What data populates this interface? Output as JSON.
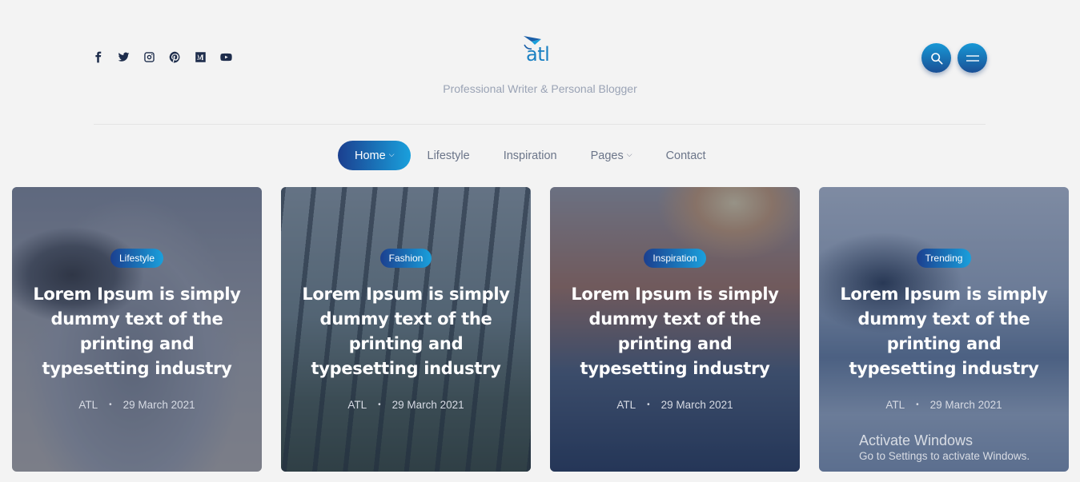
{
  "header": {
    "logo_text": "atl",
    "tagline": "Professional Writer & Personal Blogger",
    "social": [
      {
        "icon": "facebook-icon"
      },
      {
        "icon": "twitter-icon"
      },
      {
        "icon": "instagram-icon"
      },
      {
        "icon": "pinterest-icon"
      },
      {
        "icon": "medium-icon"
      },
      {
        "icon": "youtube-icon"
      }
    ]
  },
  "nav": {
    "items": [
      {
        "label": "Home",
        "chevron": "⌵",
        "active": true
      },
      {
        "label": "Lifestyle"
      },
      {
        "label": "Inspiration"
      },
      {
        "label": "Pages",
        "chevron": "⌵"
      },
      {
        "label": "Contact"
      }
    ]
  },
  "cards": [
    {
      "category": "Lifestyle",
      "title": "Lorem Ipsum is simply dummy text of the printing and typesetting industry",
      "author": "ATL",
      "dot": "•",
      "date": "29 March 2021"
    },
    {
      "category": "Fashion",
      "title": "Lorem Ipsum is simply dummy text of the printing and typesetting industry",
      "author": "ATL",
      "dot": "•",
      "date": "29 March 2021"
    },
    {
      "category": "Inspiration",
      "title": "Lorem Ipsum is simply dummy text of the printing and typesetting industry",
      "author": "ATL",
      "dot": "•",
      "date": "29 March 2021"
    },
    {
      "category": "Trending",
      "title": "Lorem Ipsum is simply dummy text of the printing and typesetting industry",
      "author": "ATL",
      "dot": "•",
      "date": "29 March 2021"
    }
  ],
  "watermark": {
    "line1": "Activate Windows",
    "line2": "Go to Settings to activate Windows."
  },
  "colors": {
    "accent_start": "#1b3f8f",
    "accent_end": "#1aa0dc",
    "background": "#f3f3f3"
  }
}
